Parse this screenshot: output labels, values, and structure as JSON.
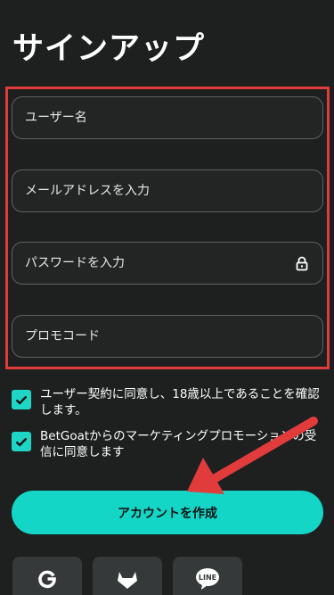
{
  "page": {
    "title": "サインアップ"
  },
  "form": {
    "username_placeholder": "ユーザー名",
    "email_placeholder": "メールアドレスを入力",
    "password_placeholder": "パスワードを入力",
    "promo_placeholder": "プロモコード"
  },
  "consents": [
    {
      "label": "ユーザー契約に同意し、18歳以上であることを確認します。",
      "checked": true
    },
    {
      "label": "BetGoatからのマーケティングプロモーションの受信に同意します",
      "checked": true
    }
  ],
  "submit_label": "アカウントを作成",
  "social": [
    {
      "icon": "google-icon"
    },
    {
      "icon": "gitlab-icon"
    },
    {
      "icon": "line-icon",
      "text": "LINE"
    }
  ],
  "colors": {
    "background": "#1e2020",
    "accent": "#14d6c6",
    "annotation": "#e23b3b"
  }
}
